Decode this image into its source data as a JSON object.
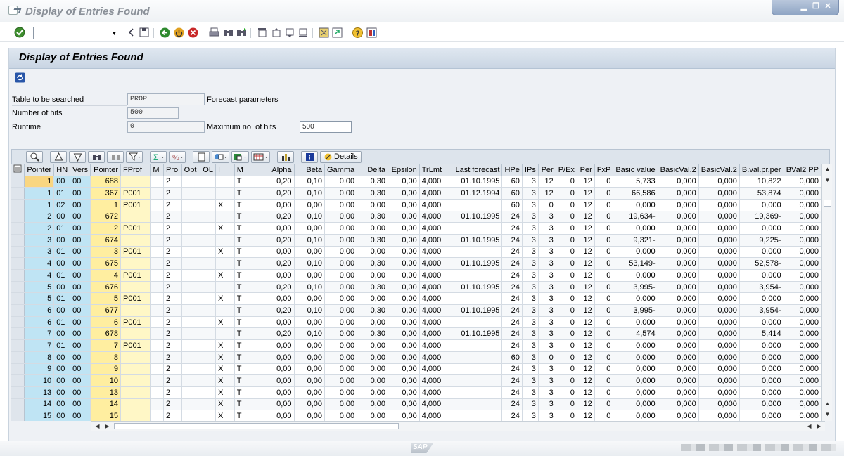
{
  "window": {
    "title": "Display of Entries Found"
  },
  "toolbar": {
    "command_value": ""
  },
  "screen": {
    "title": "Display of Entries Found"
  },
  "selection": {
    "table_label": "Table to be searched",
    "table_value": "PROP",
    "table_desc": "Forecast parameters",
    "hits_label": "Number of hits",
    "hits_value": "500",
    "runtime_label": "Runtime",
    "runtime_value": "0",
    "maxhits_label": "Maximum no. of hits",
    "maxhits_value": "500"
  },
  "grid_toolbar": {
    "details_label": "Details"
  },
  "grid": {
    "columns": [
      "Pointer",
      "HN",
      "Vers",
      "Pointer",
      "FProf",
      "M",
      "Pro",
      "Opt",
      "OL",
      "I",
      "M",
      "Alpha",
      "Beta",
      "Gamma",
      "Delta",
      "Epsilon",
      "TrLmt",
      "Last forecast",
      "HPe",
      "IPs",
      "Per",
      "P/Ex",
      "Per",
      "FxP",
      "Basic value",
      "BasicVal.2",
      "BasicVal.2",
      "B.val.pr.per",
      "BVal2 PP"
    ],
    "rows": [
      [
        "1",
        "00",
        "00",
        "688",
        "",
        "",
        "2",
        "",
        "",
        "",
        "T",
        "0,20",
        "0,10",
        "0,00",
        "0,30",
        "0,00",
        "4,000",
        "01.10.1995",
        "60",
        "3",
        "12",
        "0",
        "12",
        "0",
        "5,733",
        "0,000",
        "0,000",
        "10,822",
        "0,000"
      ],
      [
        "1",
        "01",
        "00",
        "367",
        "P001",
        "",
        "2",
        "",
        "",
        "",
        "T",
        "0,20",
        "0,10",
        "0,00",
        "0,30",
        "0,00",
        "4,000",
        "01.12.1994",
        "60",
        "3",
        "12",
        "0",
        "12",
        "0",
        "66,586",
        "0,000",
        "0,000",
        "53,874",
        "0,000"
      ],
      [
        "1",
        "02",
        "00",
        "1",
        "P001",
        "",
        "2",
        "",
        "",
        "X",
        "T",
        "0,00",
        "0,00",
        "0,00",
        "0,00",
        "0,00",
        "4,000",
        "",
        "60",
        "3",
        "0",
        "0",
        "12",
        "0",
        "0,000",
        "0,000",
        "0,000",
        "0,000",
        "0,000"
      ],
      [
        "2",
        "00",
        "00",
        "672",
        "",
        "",
        "2",
        "",
        "",
        "",
        "T",
        "0,20",
        "0,10",
        "0,00",
        "0,30",
        "0,00",
        "4,000",
        "01.10.1995",
        "24",
        "3",
        "3",
        "0",
        "12",
        "0",
        "19,634-",
        "0,000",
        "0,000",
        "19,369-",
        "0,000"
      ],
      [
        "2",
        "01",
        "00",
        "2",
        "P001",
        "",
        "2",
        "",
        "",
        "X",
        "T",
        "0,00",
        "0,00",
        "0,00",
        "0,00",
        "0,00",
        "4,000",
        "",
        "24",
        "3",
        "3",
        "0",
        "12",
        "0",
        "0,000",
        "0,000",
        "0,000",
        "0,000",
        "0,000"
      ],
      [
        "3",
        "00",
        "00",
        "674",
        "",
        "",
        "2",
        "",
        "",
        "",
        "T",
        "0,20",
        "0,10",
        "0,00",
        "0,30",
        "0,00",
        "4,000",
        "01.10.1995",
        "24",
        "3",
        "3",
        "0",
        "12",
        "0",
        "9,321-",
        "0,000",
        "0,000",
        "9,225-",
        "0,000"
      ],
      [
        "3",
        "01",
        "00",
        "3",
        "P001",
        "",
        "2",
        "",
        "",
        "X",
        "T",
        "0,00",
        "0,00",
        "0,00",
        "0,00",
        "0,00",
        "4,000",
        "",
        "24",
        "3",
        "3",
        "0",
        "12",
        "0",
        "0,000",
        "0,000",
        "0,000",
        "0,000",
        "0,000"
      ],
      [
        "4",
        "00",
        "00",
        "675",
        "",
        "",
        "2",
        "",
        "",
        "",
        "T",
        "0,20",
        "0,10",
        "0,00",
        "0,30",
        "0,00",
        "4,000",
        "01.10.1995",
        "24",
        "3",
        "3",
        "0",
        "12",
        "0",
        "53,149-",
        "0,000",
        "0,000",
        "52,578-",
        "0,000"
      ],
      [
        "4",
        "01",
        "00",
        "4",
        "P001",
        "",
        "2",
        "",
        "",
        "X",
        "T",
        "0,00",
        "0,00",
        "0,00",
        "0,00",
        "0,00",
        "4,000",
        "",
        "24",
        "3",
        "3",
        "0",
        "12",
        "0",
        "0,000",
        "0,000",
        "0,000",
        "0,000",
        "0,000"
      ],
      [
        "5",
        "00",
        "00",
        "676",
        "",
        "",
        "2",
        "",
        "",
        "",
        "T",
        "0,20",
        "0,10",
        "0,00",
        "0,30",
        "0,00",
        "4,000",
        "01.10.1995",
        "24",
        "3",
        "3",
        "0",
        "12",
        "0",
        "3,995-",
        "0,000",
        "0,000",
        "3,954-",
        "0,000"
      ],
      [
        "5",
        "01",
        "00",
        "5",
        "P001",
        "",
        "2",
        "",
        "",
        "X",
        "T",
        "0,00",
        "0,00",
        "0,00",
        "0,00",
        "0,00",
        "4,000",
        "",
        "24",
        "3",
        "3",
        "0",
        "12",
        "0",
        "0,000",
        "0,000",
        "0,000",
        "0,000",
        "0,000"
      ],
      [
        "6",
        "00",
        "00",
        "677",
        "",
        "",
        "2",
        "",
        "",
        "",
        "T",
        "0,20",
        "0,10",
        "0,00",
        "0,30",
        "0,00",
        "4,000",
        "01.10.1995",
        "24",
        "3",
        "3",
        "0",
        "12",
        "0",
        "3,995-",
        "0,000",
        "0,000",
        "3,954-",
        "0,000"
      ],
      [
        "6",
        "01",
        "00",
        "6",
        "P001",
        "",
        "2",
        "",
        "",
        "X",
        "T",
        "0,00",
        "0,00",
        "0,00",
        "0,00",
        "0,00",
        "4,000",
        "",
        "24",
        "3",
        "3",
        "0",
        "12",
        "0",
        "0,000",
        "0,000",
        "0,000",
        "0,000",
        "0,000"
      ],
      [
        "7",
        "00",
        "00",
        "678",
        "",
        "",
        "2",
        "",
        "",
        "",
        "T",
        "0,20",
        "0,10",
        "0,00",
        "0,30",
        "0,00",
        "4,000",
        "01.10.1995",
        "24",
        "3",
        "3",
        "0",
        "12",
        "0",
        "4,574",
        "0,000",
        "0,000",
        "5,414",
        "0,000"
      ],
      [
        "7",
        "01",
        "00",
        "7",
        "P001",
        "",
        "2",
        "",
        "",
        "X",
        "T",
        "0,00",
        "0,00",
        "0,00",
        "0,00",
        "0,00",
        "4,000",
        "",
        "24",
        "3",
        "3",
        "0",
        "12",
        "0",
        "0,000",
        "0,000",
        "0,000",
        "0,000",
        "0,000"
      ],
      [
        "8",
        "00",
        "00",
        "8",
        "",
        "",
        "2",
        "",
        "",
        "X",
        "T",
        "0,00",
        "0,00",
        "0,00",
        "0,00",
        "0,00",
        "4,000",
        "",
        "60",
        "3",
        "0",
        "0",
        "12",
        "0",
        "0,000",
        "0,000",
        "0,000",
        "0,000",
        "0,000"
      ],
      [
        "9",
        "00",
        "00",
        "9",
        "",
        "",
        "2",
        "",
        "",
        "X",
        "T",
        "0,00",
        "0,00",
        "0,00",
        "0,00",
        "0,00",
        "4,000",
        "",
        "24",
        "3",
        "3",
        "0",
        "12",
        "0",
        "0,000",
        "0,000",
        "0,000",
        "0,000",
        "0,000"
      ],
      [
        "10",
        "00",
        "00",
        "10",
        "",
        "",
        "2",
        "",
        "",
        "X",
        "T",
        "0,00",
        "0,00",
        "0,00",
        "0,00",
        "0,00",
        "4,000",
        "",
        "24",
        "3",
        "3",
        "0",
        "12",
        "0",
        "0,000",
        "0,000",
        "0,000",
        "0,000",
        "0,000"
      ],
      [
        "13",
        "00",
        "00",
        "13",
        "",
        "",
        "2",
        "",
        "",
        "X",
        "T",
        "0,00",
        "0,00",
        "0,00",
        "0,00",
        "0,00",
        "4,000",
        "",
        "24",
        "3",
        "3",
        "0",
        "12",
        "0",
        "0,000",
        "0,000",
        "0,000",
        "0,000",
        "0,000"
      ],
      [
        "14",
        "00",
        "00",
        "14",
        "",
        "",
        "2",
        "",
        "",
        "X",
        "T",
        "0,00",
        "0,00",
        "0,00",
        "0,00",
        "0,00",
        "4,000",
        "",
        "24",
        "3",
        "3",
        "0",
        "12",
        "0",
        "0,000",
        "0,000",
        "0,000",
        "0,000",
        "0,000"
      ],
      [
        "15",
        "00",
        "00",
        "15",
        "",
        "",
        "2",
        "",
        "",
        "X",
        "T",
        "0,00",
        "0,00",
        "0,00",
        "0,00",
        "0,00",
        "4,000",
        "",
        "24",
        "3",
        "3",
        "0",
        "12",
        "0",
        "0,000",
        "0,000",
        "0,000",
        "0,000",
        "0,000"
      ]
    ]
  },
  "status": {
    "logo": "SAP"
  },
  "colors": {
    "key_column": "#bfe4f4",
    "highlight_column": "#fff7c6",
    "current_cell": "#f9d681"
  }
}
